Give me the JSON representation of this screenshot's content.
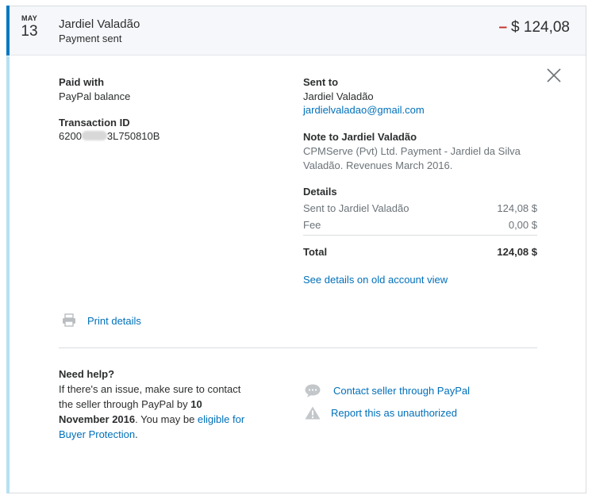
{
  "header": {
    "month": "MAY",
    "day": "13",
    "payee_name": "Jardiel Valadão",
    "status": "Payment sent",
    "amount_sign": "–",
    "amount": "$ 124,08",
    "accent_color": "#0079c1",
    "negative_color": "#c72e2e"
  },
  "left": {
    "paid_with_label": "Paid with",
    "paid_with_value": "PayPal balance",
    "transaction_id_label": "Transaction ID",
    "transaction_id_prefix": "6200",
    "transaction_id_suffix": "3L750810B",
    "print_label": "Print details",
    "print_icon": "printer-icon"
  },
  "right": {
    "sent_to_label": "Sent to",
    "sent_to_name": "Jardiel Valadão",
    "sent_to_email": "jardielvaladao@gmail.com",
    "note_label": "Note to Jardiel Valadão",
    "note_line1": "CPMServe (Pvt) Ltd. Payment - Jardiel da Silva",
    "note_line2": "Valadão. Revenues March 2016.",
    "details_label": "Details",
    "rows": [
      {
        "label": "Sent to Jardiel Valadão",
        "value": "124,08 $"
      },
      {
        "label": "Fee",
        "value": "0,00 $"
      }
    ],
    "total_label": "Total",
    "total_value": "124,08 $",
    "old_view_link": "See details on old account view"
  },
  "help": {
    "title": "Need help?",
    "line1": "If there's an issue, make sure to contact",
    "line2_pre": "the seller through PayPal by ",
    "line2_bold": "10",
    "line3_bold": "November 2016",
    "line3_post": ". You may be ",
    "line3_link": "eligible for",
    "line4_link": "Buyer Protection",
    "line4_post": ".",
    "contact_link": "Contact seller through PayPal",
    "contact_icon": "chat-bubble-icon",
    "report_link": "Report this as unauthorized",
    "report_icon": "warning-icon"
  },
  "close_icon": "close-icon"
}
